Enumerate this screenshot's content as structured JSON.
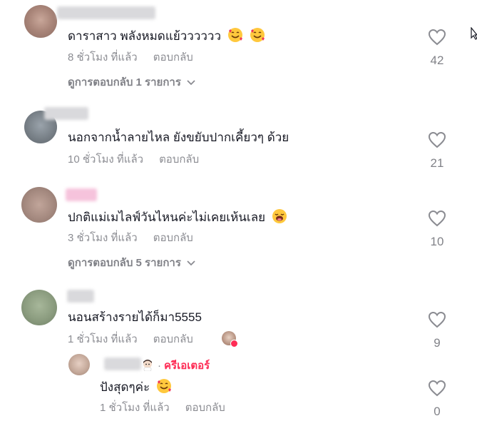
{
  "comments": [
    {
      "text": "ดาราสาว พลังหมดแย้วววววว",
      "time": "8 ชั่วโมง ที่แล้ว",
      "reply_label": "ตอบกลับ",
      "likes": "42",
      "view_replies": "ดูการตอบกลับ 1 รายการ",
      "emoji": [
        "smiling-face-with-hearts",
        "smiling-face-with-hearts"
      ]
    },
    {
      "text": "นอกจากน้ำลายไหล ยังขยับปากเคี้ยวๆ ด้วย",
      "time": "10 ชั่วโมง ที่แล้ว",
      "reply_label": "ตอบกลับ",
      "likes": "21"
    },
    {
      "text": "ปกติแม่เมไลฟ์วันไหนค่ะไม่เคยเห้นเลย",
      "time": "3 ชั่วโมง ที่แล้ว",
      "reply_label": "ตอบกลับ",
      "likes": "10",
      "view_replies": "ดูการตอบกลับ 5 รายการ",
      "emoji": [
        "drooling-face"
      ]
    },
    {
      "text": "นอนสร้างรายได้ก็มา5555",
      "time": "1 ชั่วโมง ที่แล้ว",
      "reply_label": "ตอบกลับ",
      "likes": "9"
    }
  ],
  "reply": {
    "creator_label": "ครีเอเตอร์",
    "text": "ปังสุดๆค่ะ",
    "time": "1 ชั่วโมง ที่แล้ว",
    "reply_label": "ตอบกลับ",
    "likes": "0",
    "emoji": [
      "smiling-face-with-hearts"
    ]
  },
  "colors": {
    "creator": "#fe2c55",
    "text": "#161823",
    "muted": "#8a8b91"
  }
}
